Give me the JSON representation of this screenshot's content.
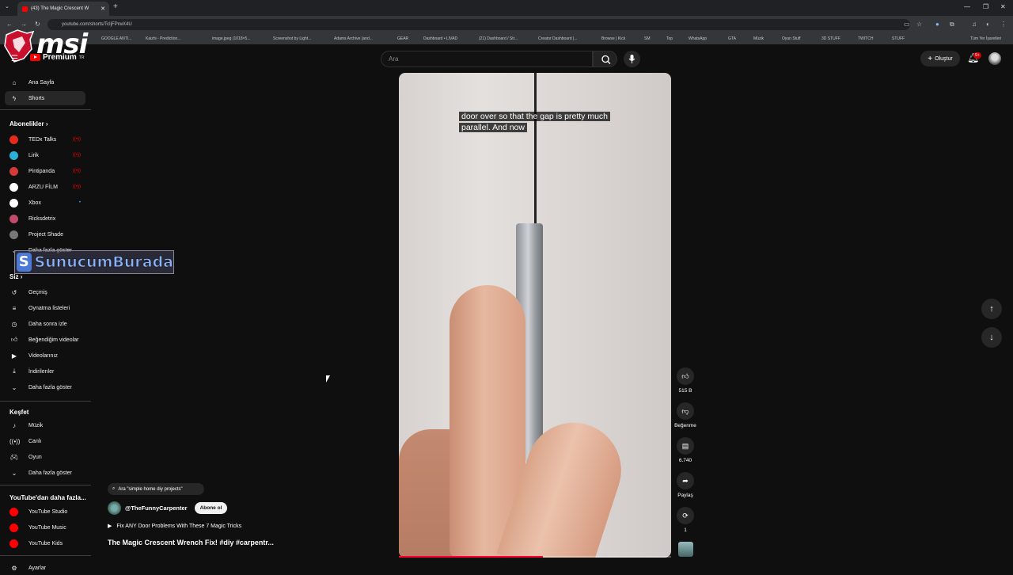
{
  "browser": {
    "tab_title": "(43) The Magic Crescent W",
    "url": "youtube.com/shorts/TcIjFPrwX4U",
    "bookmarks": [
      "GOOGLE ANTI...",
      "Kaizhi - Prediction...",
      "image.jpeg (1018×5...",
      "Screenshot by Light...",
      "Adams Archive (and...",
      "GEAR",
      "Dashboard • LIVAD",
      "(21) Dashboard / Str...",
      "Creator Dashboard |...",
      "Browse | Kick",
      "SM",
      "Top",
      "WhatsApp",
      "GTA",
      "Müzik",
      "Oyun Stuff",
      "3D STUFF",
      "TWITCH",
      "STUFF",
      "Tüm Yer İşaretleri"
    ]
  },
  "overlay": {
    "brand_logo": "msi",
    "watermark_letter": "S",
    "watermark_text": "SunucumBurada"
  },
  "header": {
    "logo_text": "Premium",
    "logo_sup": "TR",
    "search_placeholder": "Ara",
    "create_label": "Oluştur",
    "notification_badge": "9+"
  },
  "sidebar": {
    "main": [
      {
        "label": "Ana Sayfa",
        "icon": "home-icon"
      },
      {
        "label": "Shorts",
        "icon": "shorts-icon"
      }
    ],
    "subscriptions_title": "Abonelikler",
    "subscriptions": [
      {
        "label": "TEDx Talks",
        "color": "#e62b1e"
      },
      {
        "label": "Lirik",
        "color": "#2bb0d9"
      },
      {
        "label": "Pintipanda",
        "color": "#d43a3a"
      },
      {
        "label": "ARZU FİLM",
        "color": "#ffffff"
      },
      {
        "label": "Xbox",
        "color": "#ffffff"
      },
      {
        "label": "Ricksdetrix",
        "color": "#c24a6a"
      },
      {
        "label": "Project Shade",
        "color": "#777777"
      }
    ],
    "show_more_label": "Daha fazla göster",
    "you_title": "Siz",
    "you_items": [
      {
        "label": "Geçmiş",
        "icon": "history-icon"
      },
      {
        "label": "Oynatma listeleri",
        "icon": "playlist-icon"
      },
      {
        "label": "Daha sonra izle",
        "icon": "clock-icon"
      },
      {
        "label": "Beğendiğim videolar",
        "icon": "like-icon"
      },
      {
        "label": "Videolarınız",
        "icon": "video-icon"
      },
      {
        "label": "İndirilenler",
        "icon": "download-icon"
      },
      {
        "label": "Daha fazla göster",
        "icon": "chevron-down-icon"
      }
    ],
    "explore_title": "Keşfet",
    "explore_items": [
      {
        "label": "Müzik",
        "icon": "music-icon"
      },
      {
        "label": "Canlı",
        "icon": "live-icon"
      },
      {
        "label": "Oyun",
        "icon": "game-icon"
      },
      {
        "label": "Daha fazla göster",
        "icon": "chevron-down-icon"
      }
    ],
    "more_title": "YouTube'dan daha fazla...",
    "more_items": [
      {
        "label": "YouTube Studio"
      },
      {
        "label": "YouTube Music"
      },
      {
        "label": "YouTube Kids"
      }
    ],
    "settings_label": "Ayarlar"
  },
  "video": {
    "caption_line1": "door over so that the gap is pretty much",
    "caption_line2": "parallel. And now",
    "progress": 0.53
  },
  "info": {
    "search_chip": "Ara \"simple home diy projects\"",
    "channel": "@TheFunnyCarpenter",
    "subscribe_label": "Abone ol",
    "playlist": "Fix ANY Door Problems With These 7 Magic Tricks",
    "title": "The Magic Crescent Wrench Fix!  #diy #carpentr..."
  },
  "actions": {
    "likes": "515 B",
    "dislike_label": "Beğenme",
    "comments": "6.740",
    "share_label": "Paylaş",
    "remix_count": "1"
  }
}
